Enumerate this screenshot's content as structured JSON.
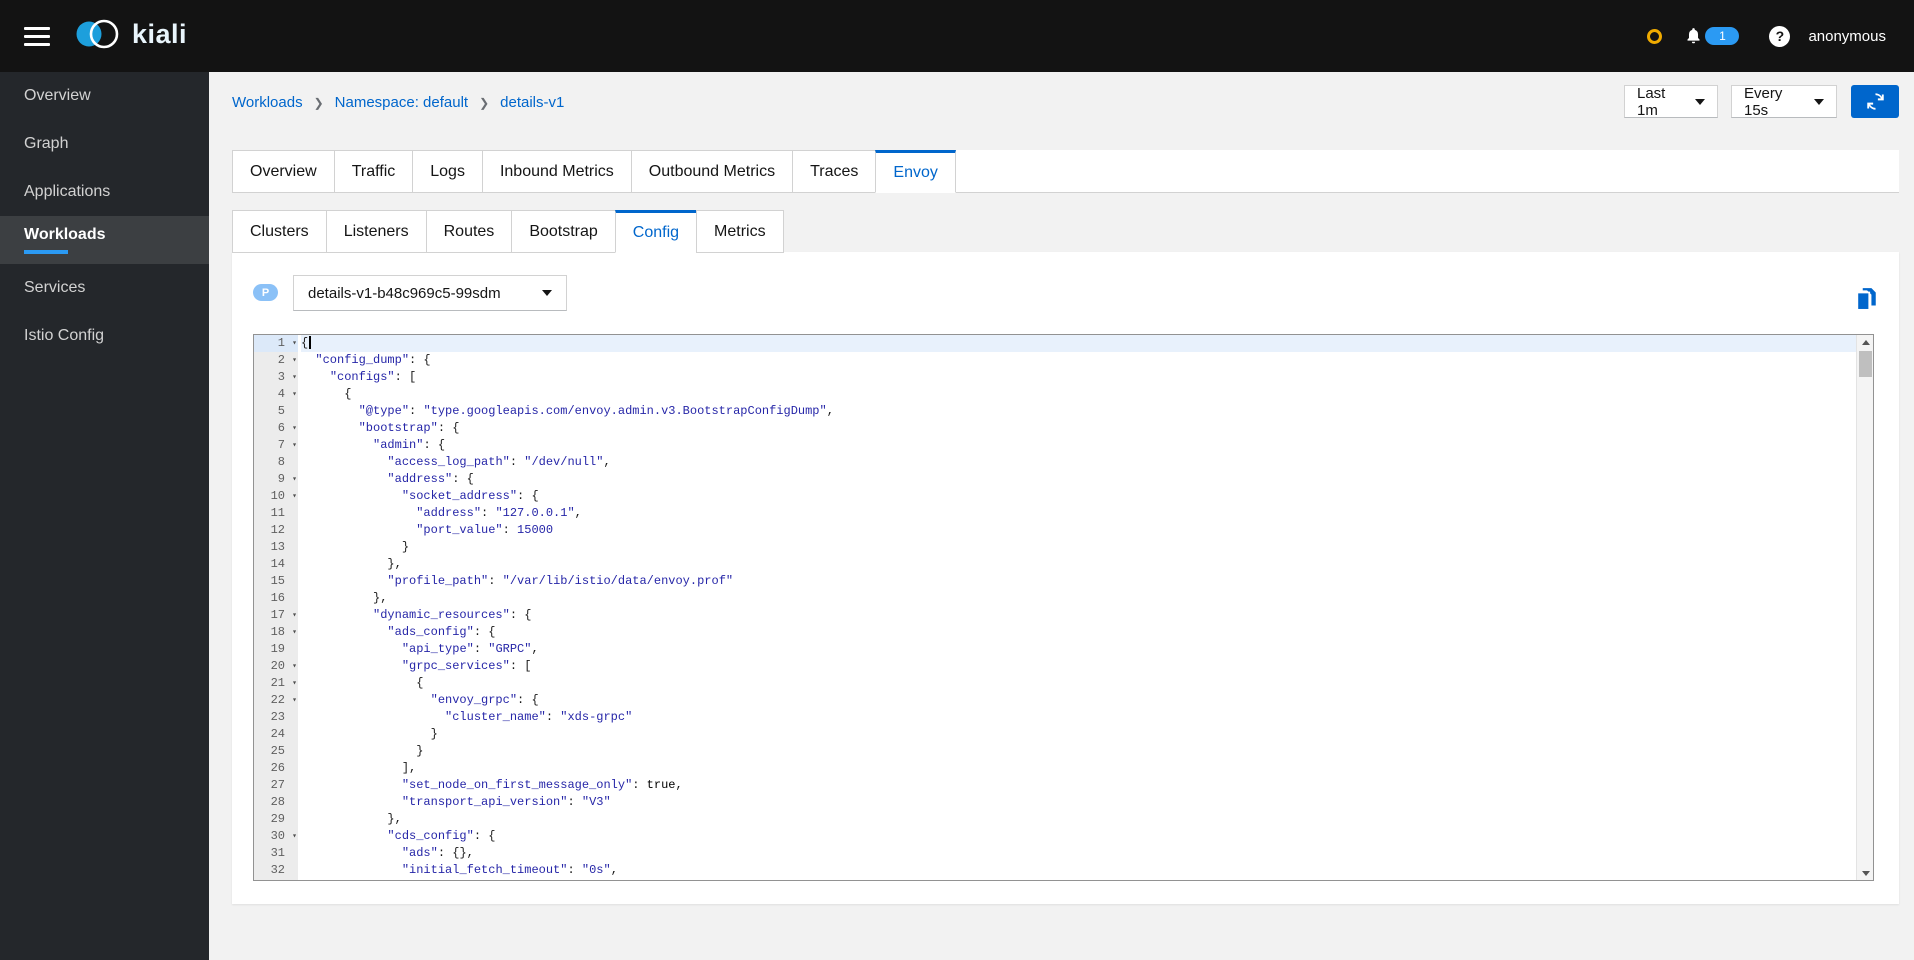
{
  "masthead": {
    "brand": "kiali",
    "username": "anonymous",
    "notification_count": "1",
    "colors": {
      "istio_status": "#f0ab00",
      "notification_badge": "#2b9af3",
      "masthead_bg": "#131313"
    }
  },
  "sidebar": {
    "items": [
      {
        "label": "Overview",
        "active": false
      },
      {
        "label": "Graph",
        "active": false
      },
      {
        "label": "Applications",
        "active": false
      },
      {
        "label": "Workloads",
        "active": true
      },
      {
        "label": "Services",
        "active": false
      },
      {
        "label": "Istio Config",
        "active": false
      }
    ],
    "colors": {
      "bg": "#24272b",
      "active_bg": "#3c3f42",
      "active_bar": "#2b9af3"
    }
  },
  "breadcrumb": {
    "items": [
      "Workloads",
      "Namespace: default",
      "details-v1"
    ]
  },
  "toolbar": {
    "duration": "Last 1m",
    "refresh_interval": "Every 15s",
    "refresh_button_color": "#0066cc"
  },
  "tabs": {
    "main": [
      "Overview",
      "Traffic",
      "Logs",
      "Inbound Metrics",
      "Outbound Metrics",
      "Traces",
      "Envoy"
    ],
    "main_active": "Envoy",
    "sub": [
      "Clusters",
      "Listeners",
      "Routes",
      "Bootstrap",
      "Config",
      "Metrics"
    ],
    "sub_active": "Config",
    "active_color": "#0066cc"
  },
  "pod_selector": {
    "badge": "P",
    "selected": "details-v1-b48c969c5-99sdm"
  },
  "icons": {
    "hamburger": "menu-bars",
    "kiali_logo": "two-overlapping-circles",
    "istio_status": "amber-ring",
    "bell": "notification-bell",
    "help": "question-mark-circle",
    "refresh": "sync-arrows",
    "copy": "copy-documents",
    "caret": "caret-down",
    "fold": "caret-down-small"
  },
  "editor": {
    "string_color": "#2626a8",
    "active_line_bg": "#e8f1fc",
    "lines": [
      {
        "n": 1,
        "t": "{",
        "fold": true,
        "cursor": true
      },
      {
        "n": 2,
        "t": "  \"config_dump\": {",
        "fold": true
      },
      {
        "n": 3,
        "t": "    \"configs\": [",
        "fold": true
      },
      {
        "n": 4,
        "t": "      {",
        "fold": true
      },
      {
        "n": 5,
        "t": "        \"@type\": \"type.googleapis.com/envoy.admin.v3.BootstrapConfigDump\","
      },
      {
        "n": 6,
        "t": "        \"bootstrap\": {",
        "fold": true
      },
      {
        "n": 7,
        "t": "          \"admin\": {",
        "fold": true
      },
      {
        "n": 8,
        "t": "            \"access_log_path\": \"/dev/null\","
      },
      {
        "n": 9,
        "t": "            \"address\": {",
        "fold": true
      },
      {
        "n": 10,
        "t": "              \"socket_address\": {",
        "fold": true
      },
      {
        "n": 11,
        "t": "                \"address\": \"127.0.0.1\","
      },
      {
        "n": 12,
        "t": "                \"port_value\": 15000"
      },
      {
        "n": 13,
        "t": "              }"
      },
      {
        "n": 14,
        "t": "            },"
      },
      {
        "n": 15,
        "t": "            \"profile_path\": \"/var/lib/istio/data/envoy.prof\""
      },
      {
        "n": 16,
        "t": "          },"
      },
      {
        "n": 17,
        "t": "          \"dynamic_resources\": {",
        "fold": true
      },
      {
        "n": 18,
        "t": "            \"ads_config\": {",
        "fold": true
      },
      {
        "n": 19,
        "t": "              \"api_type\": \"GRPC\","
      },
      {
        "n": 20,
        "t": "              \"grpc_services\": [",
        "fold": true
      },
      {
        "n": 21,
        "t": "                {",
        "fold": true
      },
      {
        "n": 22,
        "t": "                  \"envoy_grpc\": {",
        "fold": true
      },
      {
        "n": 23,
        "t": "                    \"cluster_name\": \"xds-grpc\""
      },
      {
        "n": 24,
        "t": "                  }"
      },
      {
        "n": 25,
        "t": "                }"
      },
      {
        "n": 26,
        "t": "              ],"
      },
      {
        "n": 27,
        "t": "              \"set_node_on_first_message_only\": true,"
      },
      {
        "n": 28,
        "t": "              \"transport_api_version\": \"V3\""
      },
      {
        "n": 29,
        "t": "            },"
      },
      {
        "n": 30,
        "t": "            \"cds_config\": {",
        "fold": true
      },
      {
        "n": 31,
        "t": "              \"ads\": {},"
      },
      {
        "n": 32,
        "t": "              \"initial_fetch_timeout\": \"0s\","
      }
    ]
  }
}
